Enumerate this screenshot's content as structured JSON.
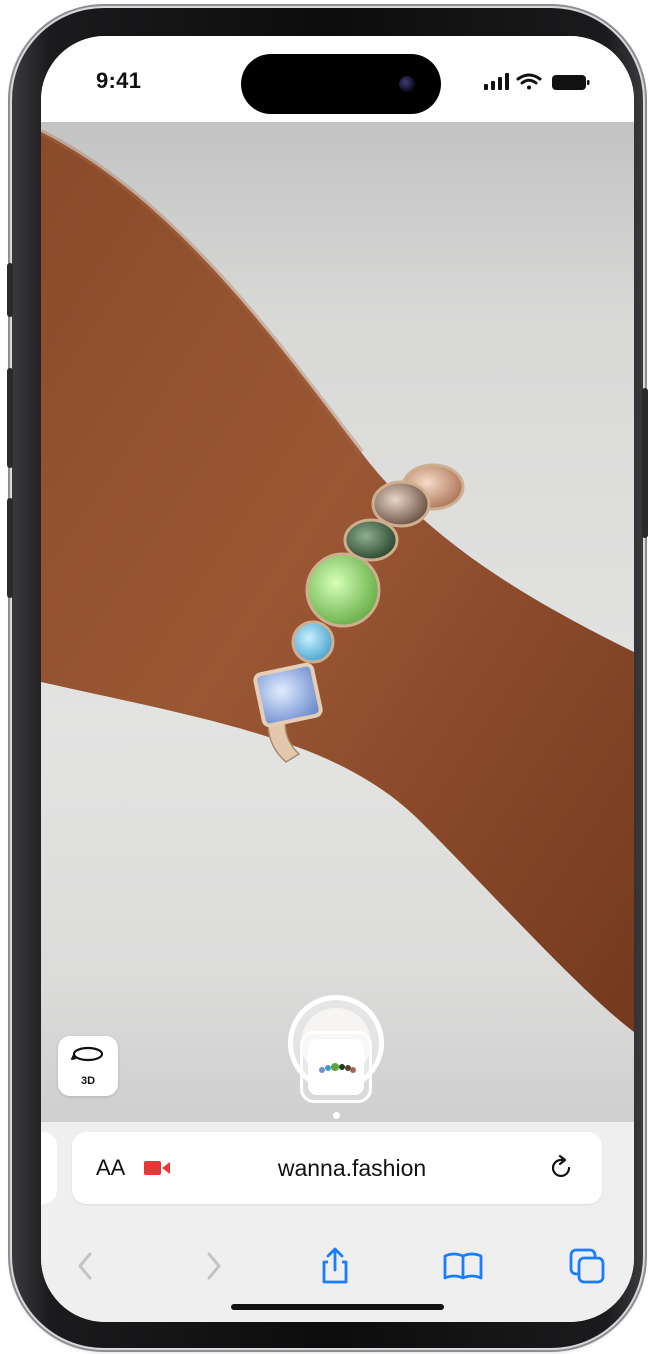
{
  "status_bar": {
    "time": "9:41",
    "icons": [
      "cellular-signal-icon",
      "wifi-icon",
      "battery-icon"
    ]
  },
  "camera_view": {
    "subject": "bracelet-ar-preview",
    "view_3d_button_label": "3D",
    "page_indicator_count": 1
  },
  "safari": {
    "address_bar": {
      "text_size_label": "AA",
      "url": "wanna.fashion",
      "recording_indicator_color": "#e53935"
    },
    "toolbar": {
      "icons": [
        "back-icon",
        "forward-icon",
        "share-icon",
        "bookmarks-icon",
        "tabs-icon"
      ],
      "accent_color": "#1a7cff",
      "disabled_color": "#c4c4c8"
    }
  }
}
